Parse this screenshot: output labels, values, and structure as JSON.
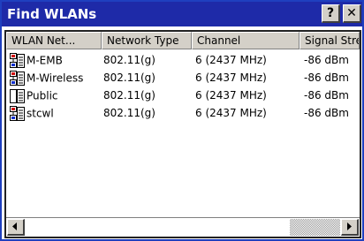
{
  "window": {
    "title": "Find WLANs",
    "help_label": "?",
    "close_label": "✕"
  },
  "columns": [
    "WLAN Net...",
    "Network Type",
    "Channel",
    "Signal Stre"
  ],
  "rows": [
    {
      "icon": "wireless-network-icon",
      "name": "M-EMB",
      "type": "802.11(g)",
      "channel": "6 (2437 MHz)",
      "signal": "-86 dBm"
    },
    {
      "icon": "wireless-network-icon",
      "name": "M-Wireless",
      "type": "802.11(g)",
      "channel": "6 (2437 MHz)",
      "signal": "-86 dBm"
    },
    {
      "icon": "open-network-icon",
      "name": "Public",
      "type": "802.11(g)",
      "channel": "6 (2437 MHz)",
      "signal": "-86 dBm"
    },
    {
      "icon": "wireless-network-icon",
      "name": "stcwl",
      "type": "802.11(g)",
      "channel": "6 (2437 MHz)",
      "signal": "-86 dBm"
    }
  ],
  "colors": {
    "titlebar": "#1e2aa8",
    "window_border": "#1f3fbf",
    "control_face": "#d4d0c8"
  }
}
